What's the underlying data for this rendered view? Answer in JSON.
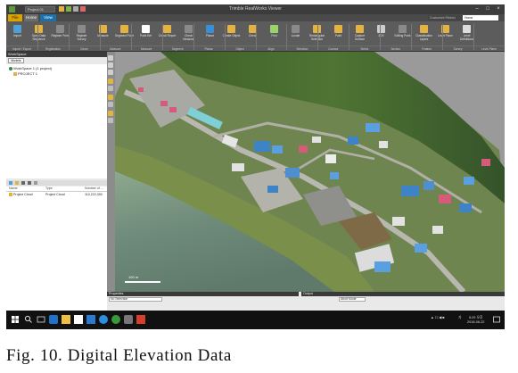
{
  "window": {
    "title": "Trimble RealWorks Viewer",
    "project_select": "Project 01",
    "controls": [
      "–",
      "□",
      "×"
    ]
  },
  "ribbon_tabs": [
    "File",
    "Home",
    "View"
  ],
  "search": {
    "placeholder": "Customize Ribbon",
    "scope": "Home"
  },
  "ribbon": {
    "buttons": [
      {
        "label": "Import",
        "icon": "import-icon",
        "color": "#4ea0d8"
      },
      {
        "label": "Open Data Sequence",
        "icon": "open-icon",
        "color": "#e3b341"
      },
      {
        "label": "Register Point",
        "icon": "register-icon",
        "color": "#8a8a8a"
      },
      {
        "label": "Register Survey",
        "icon": "survey-icon",
        "color": "#8a8a8a"
      },
      {
        "label": "Measure",
        "icon": "measure-icon",
        "color": "#e3b341"
      },
      {
        "label": "Segment Point",
        "icon": "segment-icon",
        "color": "#e3b341"
      },
      {
        "label": "Point Set",
        "icon": "pointset-icon",
        "color": "#ffffff"
      },
      {
        "label": "Check Report",
        "icon": "report-icon",
        "color": "#e3b341"
      },
      {
        "label": "Check Measure",
        "icon": "check-icon",
        "color": "#8a8a8a"
      },
      {
        "label": "Planar",
        "icon": "planar-icon",
        "color": "#3a8ed6"
      },
      {
        "label": "Create Object",
        "icon": "object-icon",
        "color": "#e3b341"
      },
      {
        "label": "Check",
        "icon": "check2-icon",
        "color": "#e3b341"
      },
      {
        "label": "Find",
        "icon": "find-icon",
        "color": "#9ad26b"
      },
      {
        "label": "Locate",
        "icon": "locate-icon",
        "color": "#8a8a8a"
      },
      {
        "label": "Rectangular Selection",
        "icon": "rect-select-icon",
        "color": "#e3b341"
      },
      {
        "label": "Point",
        "icon": "point-icon",
        "color": "#e3b341"
      },
      {
        "label": "Capture Surface",
        "icon": "capture-icon",
        "color": "#e3b341"
      },
      {
        "label": "3DX",
        "icon": "3dx-icon",
        "color": "#cccccc"
      },
      {
        "label": "Editing Point",
        "icon": "edit-point-icon",
        "color": "#8a8a8a"
      },
      {
        "label": "Classification Layers",
        "icon": "class-icon",
        "color": "#e3b341"
      },
      {
        "label": "Level Plane",
        "icon": "level-icon",
        "color": "#e3b341"
      },
      {
        "label": "Level Definitions",
        "icon": "leveldef-icon",
        "color": "#dddddd"
      }
    ],
    "groups": [
      "Import / Export",
      "Registration",
      "Clean",
      "Measure",
      "Measure",
      "Segment",
      "Planar",
      "Object",
      "Align",
      "Selection",
      "Contour",
      "Select",
      "Section",
      "Feature",
      "Survey",
      "Level Plane"
    ]
  },
  "left_panel": {
    "title": "WorkSpace",
    "tab": "Models",
    "tree": [
      {
        "label": "WorkSpace 1 (1 project)",
        "icon": "workspace-icon"
      },
      {
        "label": "PROJECT 1",
        "icon": "project-icon"
      }
    ],
    "table": {
      "columns": [
        "Name",
        "Type",
        "Number of ..."
      ],
      "rows": [
        {
          "name": "Project Cloud",
          "type": "Project Cloud",
          "count": "110,222,390"
        }
      ]
    }
  },
  "bottom": {
    "properties_title": "Properties",
    "properties_value": "No Selection",
    "output_title": "Output",
    "output_value": "Abort Mode"
  },
  "viewport": {
    "scale_label": "100 m"
  },
  "taskbar": {
    "time": "5:29 오후",
    "date": "2018-06-22",
    "lang": "가"
  },
  "caption": "Fig. 10. Digital Elevation Data"
}
